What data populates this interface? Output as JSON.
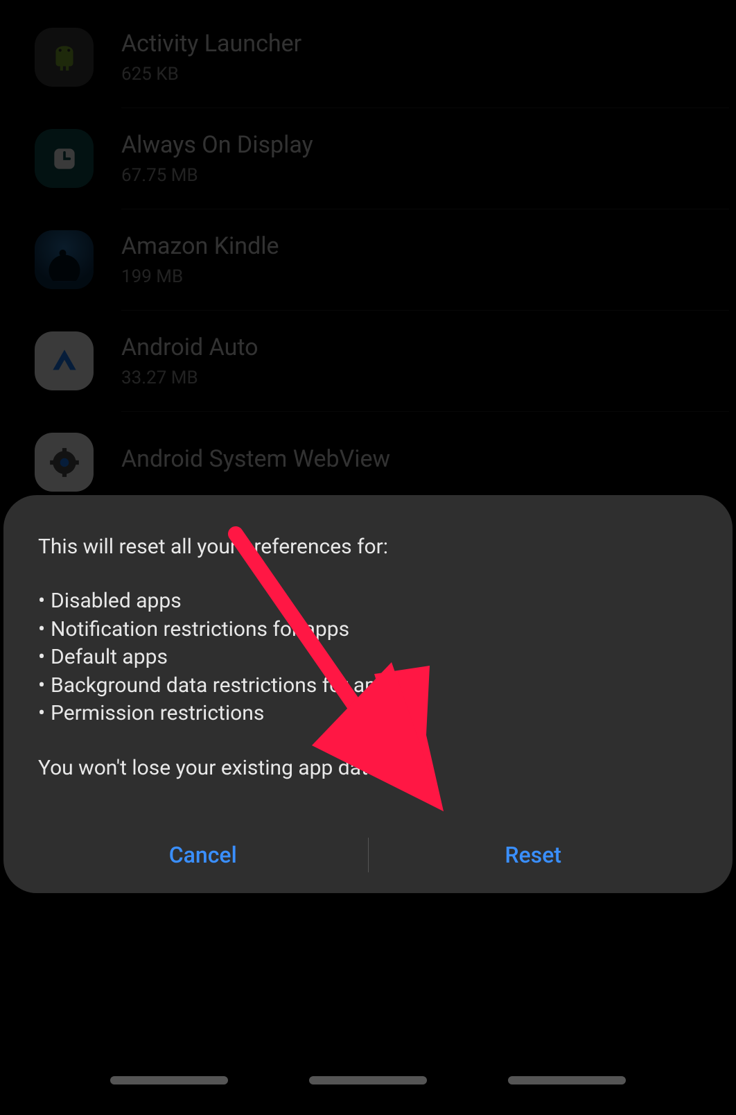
{
  "apps": [
    {
      "name": "Activity Launcher",
      "size": "625 KB",
      "iconClass": "icon-activity",
      "iconName": "android-robot-icon"
    },
    {
      "name": "Always On Display",
      "size": "67.75 MB",
      "iconClass": "icon-aod",
      "iconName": "clock-icon"
    },
    {
      "name": "Amazon Kindle",
      "size": "199 MB",
      "iconClass": "icon-kindle",
      "iconName": "kindle-reader-icon"
    },
    {
      "name": "Android Auto",
      "size": "33.27 MB",
      "iconClass": "icon-auto",
      "iconName": "android-auto-icon"
    },
    {
      "name": "Android System WebView",
      "size": "",
      "iconClass": "icon-webview",
      "iconName": "gear-globe-icon"
    }
  ],
  "dialog": {
    "intro": "This will reset all your preferences for:",
    "items": [
      "Disabled apps",
      "Notification restrictions for apps",
      "Default apps",
      "Background data restrictions for apps",
      "Permission restrictions"
    ],
    "footer": "You won't lose your existing app data.",
    "cancel": "Cancel",
    "confirm": "Reset"
  },
  "annotation": {
    "arrow_color": "#ff1744"
  }
}
